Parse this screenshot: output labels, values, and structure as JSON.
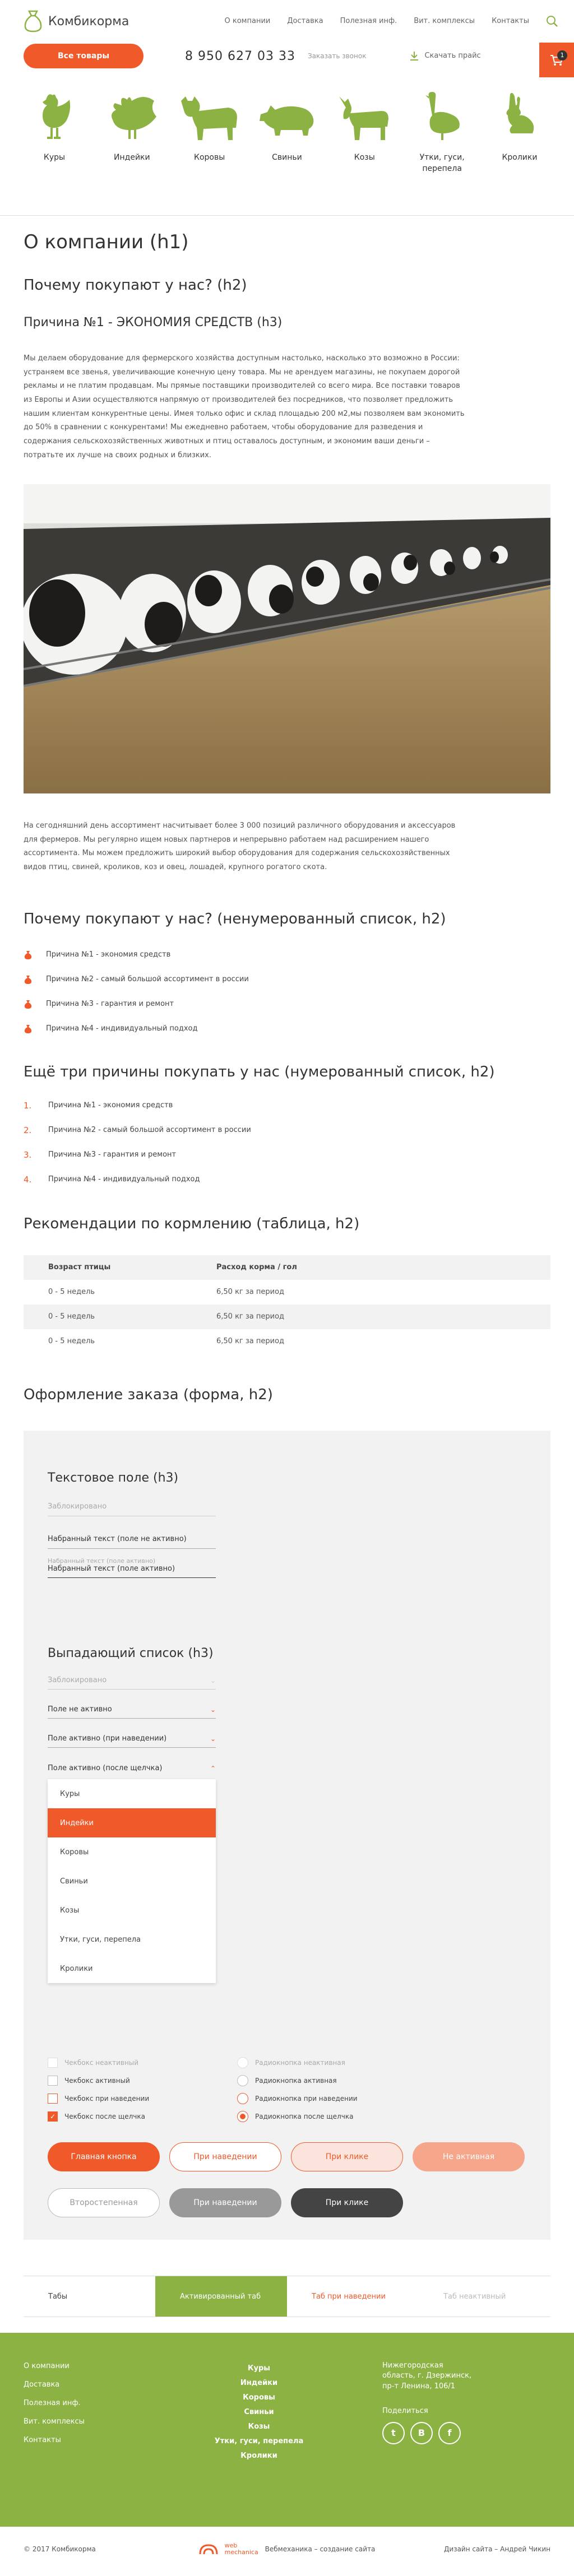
{
  "header": {
    "logo_text": "Комбикорма",
    "nav": [
      "О компании",
      "Доставка",
      "Полезная инф.",
      "Вит. комплексы",
      "Контакты"
    ],
    "all_goods": "Все товары",
    "phone": "8 950 627 03 33",
    "callback": "Заказать звонок",
    "price": "Скачать прайс",
    "cart_count": "1"
  },
  "categories": [
    "Куры",
    "Индейки",
    "Коровы",
    "Свиньи",
    "Козы",
    "Утки, гуси, перепела",
    "Кролики"
  ],
  "content": {
    "h1": "О компании (h1)",
    "h2_why": "Почему покупают у нас? (h2)",
    "h3_reason": "Причина №1 - ЭКОНОМИЯ СРЕДСТВ (h3)",
    "p1": "Мы делаем оборудование для фермерского хозяйства доступным настолько, насколько это возможно в России: устраняем все звенья, увеличивающие конечную цену товара. Мы не арендуем магазины, не покупаем дорогой рекламы и не платим продавцам. Мы прямые поставщики производителей со всего мира. Все поставки товаров из Европы и Азии осуществляются напрямую от производителей без посредников, что позволяет предложить нашим клиентам конкурентные цены. Имея только офис и склад площадью 200 м2,мы позволяем вам экономить до 50% в сравнении с конкурентами! Мы ежедневно работаем, чтобы оборудование для разведения и содержания сельскохозяйственных животных и птиц оставалось доступным, и экономим ваши деньги – потратьте их лучше на своих родных и близких.",
    "p2": "На сегодняшний день ассортимент насчитывает более 3 000 позиций различного оборудования и аксессуаров для фермеров. Мы регулярно ищем новых партнеров и непрерывно работаем над расширением нашего ассортимента. Мы можем предложить широкий выбор оборудования для содержания сельскохозяйственных видов птиц, свиней, кроликов, коз и овец, лошадей, крупного рогатого скота.",
    "h2_ul": "Почему покупают у нас? (ненумерованный список, h2)",
    "ul": [
      "Причина №1 - экономия средств",
      "Причина №2 - самый большой ассортимент в россии",
      "Причина №3 - гарантия и ремонт",
      "Причина №4 - индивидуальный подход"
    ],
    "h2_ol": "Ещё три причины покупать у нас (нумерованный список, h2)",
    "ol": [
      "Причина №1 - экономия средств",
      "Причина №2 - самый большой ассортимент в россии",
      "Причина №3 - гарантия и ремонт",
      "Причина №4 - индивидуальный подход"
    ],
    "h2_table": "Рекомендации по кормлению (таблица, h2)",
    "table": {
      "headers": [
        "Возраст птицы",
        "Расход корма / гол"
      ],
      "rows": [
        [
          "0 - 5 недель",
          "6,50 кг за период"
        ],
        [
          "0 - 5 недель",
          "6,50 кг за период"
        ],
        [
          "0 - 5 недель",
          "6,50 кг за период"
        ]
      ]
    },
    "h2_form": "Оформление заказа (форма, h2)"
  },
  "form": {
    "h3_text": "Текстовое поле (h3)",
    "disabled_field": "Заблокировано",
    "typed_inactive": "Набранный текст (поле не активно)",
    "typed_active_label": "Набранный текст (поле активно)",
    "typed_active": "Набранный текст (поле активно)",
    "h3_select": "Выпадающий список (h3)",
    "dd_disabled": "Заблокировано",
    "dd_inactive": "Поле не активно",
    "dd_hover": "Поле активно (при наведении)",
    "dd_open": "Поле активно (после щелчка)",
    "dd_options": [
      "Куры",
      "Индейки",
      "Коровы",
      "Свиньи",
      "Козы",
      "Утки, гуси, перепела",
      "Кролики"
    ],
    "checkboxes": [
      "Чекбокс неактивный",
      "Чекбокс активный",
      "Чекбокс при наведении",
      "Чекбокс после щелчка"
    ],
    "radios": [
      "Радиокнопка неактивная",
      "Радиокнопка активная",
      "Радиокнопка при наведении",
      "Радиокнопка после щелчка"
    ],
    "buttons_row1": [
      "Главная кнопка",
      "При наведении",
      "При клике",
      "Не активная"
    ],
    "buttons_row2": [
      "Второстепенная",
      "При наведении",
      "При клике"
    ]
  },
  "tabs": [
    "Табы",
    "Активированный таб",
    "Таб при наведении",
    "Таб неактивный"
  ],
  "footer": {
    "links": [
      "О компании",
      "Доставка",
      "Полезная инф.",
      "Вит. комплексы",
      "Контакты"
    ],
    "cats": [
      "Куры",
      "Индейки",
      "Коровы",
      "Свиньи",
      "Козы",
      "Утки, гуси, перепела",
      "Кролики"
    ],
    "address": "Нижегородская область, г. Дзержинск, пр-т Ленина, 106/1",
    "share": "Поделиться",
    "copyright": "© 2017 Комбикорма",
    "dev_brand": "web mechanica",
    "dev_text": "Вебмеханика – создание сайта",
    "design": "Дизайн сайта – Андрей Чикин"
  }
}
